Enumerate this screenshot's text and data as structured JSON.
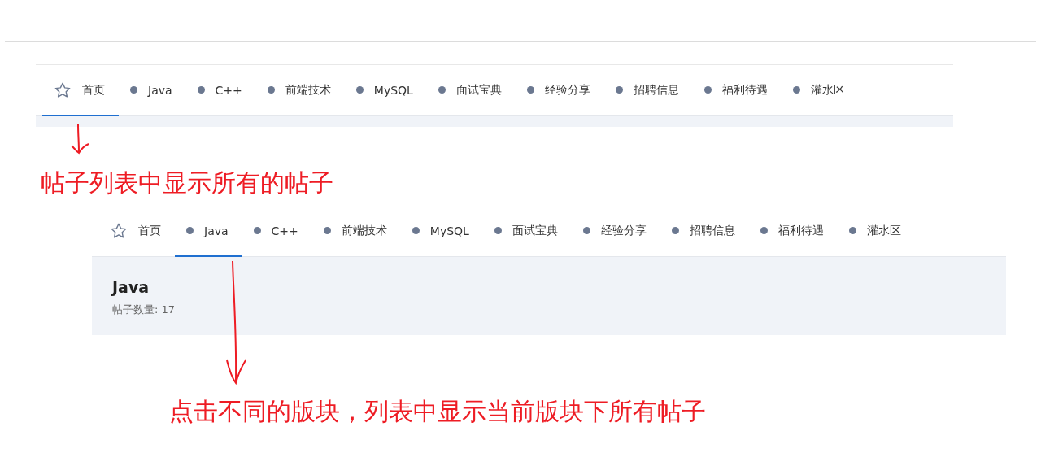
{
  "navbars": [
    {
      "tabs": [
        {
          "kind": "home",
          "label": "首页",
          "selected": true
        },
        {
          "kind": "category",
          "label": "Java",
          "selected": false
        },
        {
          "kind": "category",
          "label": "C++",
          "selected": false
        },
        {
          "kind": "category",
          "label": "前端技术",
          "selected": false
        },
        {
          "kind": "category",
          "label": "MySQL",
          "selected": false
        },
        {
          "kind": "category",
          "label": "面试宝典",
          "selected": false
        },
        {
          "kind": "category",
          "label": "经验分享",
          "selected": false
        },
        {
          "kind": "category",
          "label": "招聘信息",
          "selected": false
        },
        {
          "kind": "category",
          "label": "福利待遇",
          "selected": false
        },
        {
          "kind": "category",
          "label": "灌水区",
          "selected": false
        }
      ]
    },
    {
      "tabs": [
        {
          "kind": "home",
          "label": "首页",
          "selected": false
        },
        {
          "kind": "category",
          "label": "Java",
          "selected": true
        },
        {
          "kind": "category",
          "label": "C++",
          "selected": false
        },
        {
          "kind": "category",
          "label": "前端技术",
          "selected": false
        },
        {
          "kind": "category",
          "label": "MySQL",
          "selected": false
        },
        {
          "kind": "category",
          "label": "面试宝典",
          "selected": false
        },
        {
          "kind": "category",
          "label": "经验分享",
          "selected": false
        },
        {
          "kind": "category",
          "label": "招聘信息",
          "selected": false
        },
        {
          "kind": "category",
          "label": "福利待遇",
          "selected": false
        },
        {
          "kind": "category",
          "label": "灌水区",
          "selected": false
        }
      ],
      "board": {
        "title": "Java",
        "post_count": "帖子数量: 17"
      }
    }
  ],
  "annotations": [
    {
      "text": "帖子列表中显示所有的帖子"
    },
    {
      "text": "点击不同的版块，列表中显示当前版块下所有帖子"
    }
  ]
}
